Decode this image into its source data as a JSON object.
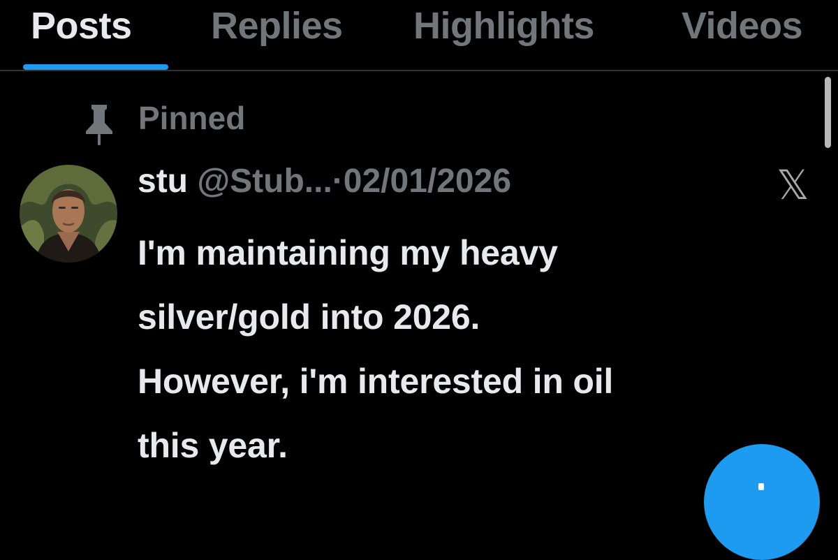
{
  "tabs": [
    {
      "label": "Posts",
      "active": true
    },
    {
      "label": "Replies",
      "active": false
    },
    {
      "label": "Highlights",
      "active": false
    },
    {
      "label": "Videos",
      "active": false
    }
  ],
  "pinned": {
    "label": "Pinned",
    "icon": "pin-icon"
  },
  "post": {
    "author_name": "stu",
    "handle": "@Stub...",
    "separator": "·",
    "date": "02/01/2026",
    "platform_logo": "𝕏",
    "body_lines": [
      "I'm maintaining my heavy",
      "silver/gold into 2026.",
      "However, i'm interested in oil",
      "this year."
    ]
  },
  "colors": {
    "background": "#000000",
    "primary_text": "#e7e9ea",
    "secondary_text": "#71767b",
    "accent": "#1d9bf0"
  }
}
